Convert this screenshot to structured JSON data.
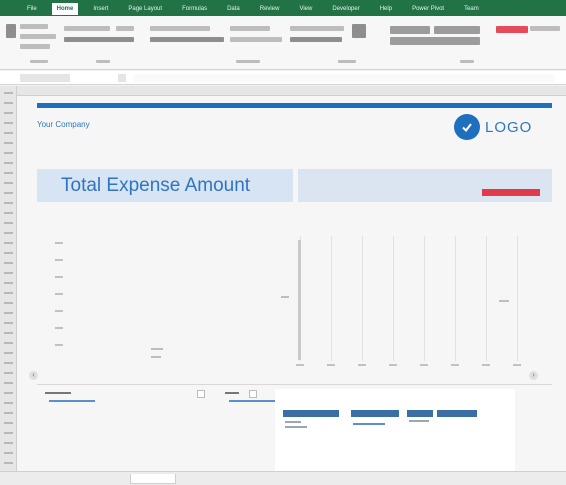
{
  "ribbon": {
    "tabs": [
      "File",
      "Home",
      "Insert",
      "Page Layout",
      "Formulas",
      "Data",
      "Review",
      "View",
      "Developer",
      "Help",
      "Power Pivot",
      "Team"
    ]
  },
  "dashboard": {
    "company_name": "Your Company",
    "company_lines": [
      "",
      "",
      ""
    ],
    "logo_text": "LOGO",
    "banner_title": "Total Expense Amount",
    "banner_value": "",
    "chart1_title": "",
    "chart2_title": "",
    "table_title": ""
  },
  "sheet_tabs": [
    "",
    "",
    "",
    "",
    ""
  ],
  "colors": {
    "excel_green": "#217346",
    "accent_blue": "#1f6fbf",
    "alert_red": "#e2394c",
    "header_blue": "#3c6ea6"
  }
}
